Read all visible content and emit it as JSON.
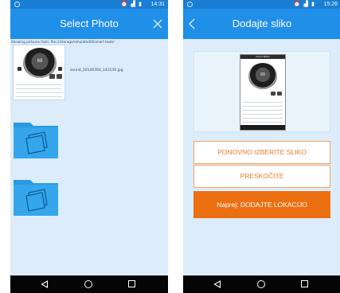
{
  "left_screen": {
    "status_bar": {
      "time": "14:31"
    },
    "title": "Select Photo",
    "path_text": "Showing pictures from: file:///storage/emulated/0/smart-tools/",
    "files": [
      {
        "name": "sound_20140304_143130.jpg",
        "gauge_reading": "69",
        "kind": "image"
      },
      {
        "kind": "folder"
      },
      {
        "kind": "folder"
      }
    ]
  },
  "right_screen": {
    "status_bar": {
      "time": "15:26"
    },
    "title": "Dodajte sliko",
    "preview": {
      "gauge_reading": "69",
      "screen_title": "Sound Meter"
    },
    "buttons": {
      "retake": "PONOVNO IZBERITE SLIKO",
      "skip": "PRESKOČITE",
      "next": "Naprej: DODAJTE LOKACIJO"
    }
  },
  "icons": {
    "close": "close-icon",
    "back": "chevron-left-icon",
    "folder": "folder-icon",
    "nav_back": "nav-back-icon",
    "nav_home": "nav-home-icon",
    "nav_recent": "nav-recent-icon"
  },
  "colors": {
    "status_bar": "#1a7ed4",
    "app_bar": "#1f8fe8",
    "screen_bg": "#dcecfa",
    "folder": "#2a9ae0",
    "accent_orange": "#ec6f12",
    "outline_orange": "#f2a463",
    "nav_bar": "#050505"
  }
}
